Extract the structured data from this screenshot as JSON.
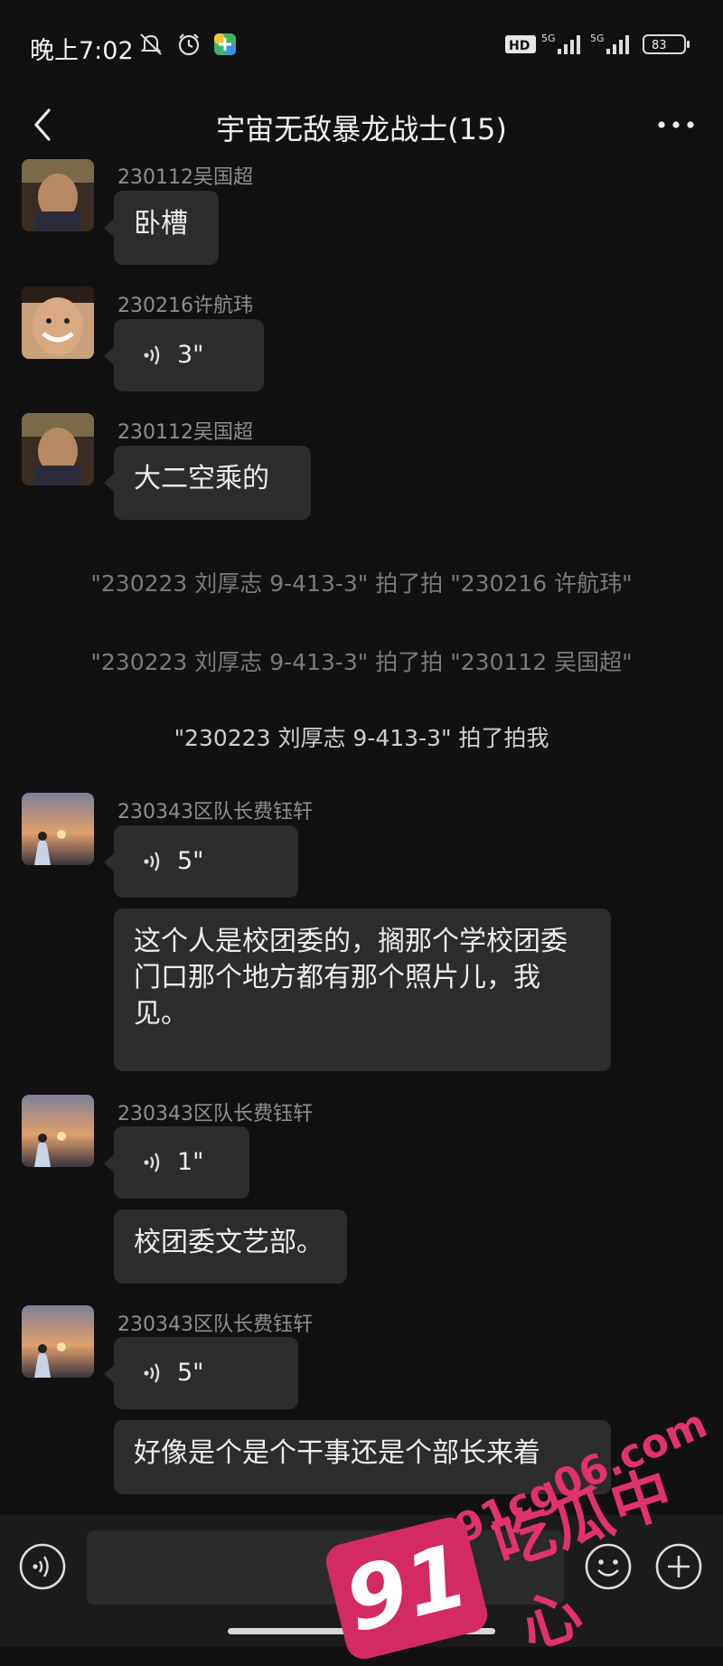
{
  "status": {
    "time": "晚上7:02",
    "battery": "83",
    "net1": "5G",
    "net2": "5G",
    "hd": "HD"
  },
  "header": {
    "title": "宇宙无敌暴龙战士(15)",
    "back_icon": "chevron-left-icon",
    "more_icon": "more-dots-icon"
  },
  "messages": [
    {
      "sender": "230112吴国超",
      "text": "卧槽"
    },
    {
      "sender": "230216许航玮",
      "voice": "3\""
    },
    {
      "sender": "230112吴国超",
      "text": "大二空乘的"
    },
    {
      "system": "\"230223 刘厚志 9-413-3\" 拍了拍 \"230216 许航玮\""
    },
    {
      "system": "\"230223 刘厚志 9-413-3\" 拍了拍 \"230112 吴国超\""
    },
    {
      "system": "\"230223 刘厚志 9-413-3\" 拍了拍我"
    },
    {
      "sender": "230343区队长费钰轩",
      "voice": "5\""
    },
    {
      "text": "这个人是校团委的，搁那个学校团委门口那个地方都有那个照片儿，我见。"
    },
    {
      "sender": "230343区队长费钰轩",
      "voice": "1\""
    },
    {
      "text": "校团委文艺部。"
    },
    {
      "sender": "230343区队长费钰轩",
      "voice": "5\""
    },
    {
      "text": "好像是个是个干事还是个部长来着"
    }
  ],
  "watermark": {
    "site": "91cg06.com",
    "brand": "吃瓜中心",
    "logo": "91"
  },
  "colors": {
    "bg": "#111111",
    "bubble": "#2c2c2c",
    "name": "#8e8e8e",
    "watermark": "#e0336c"
  }
}
